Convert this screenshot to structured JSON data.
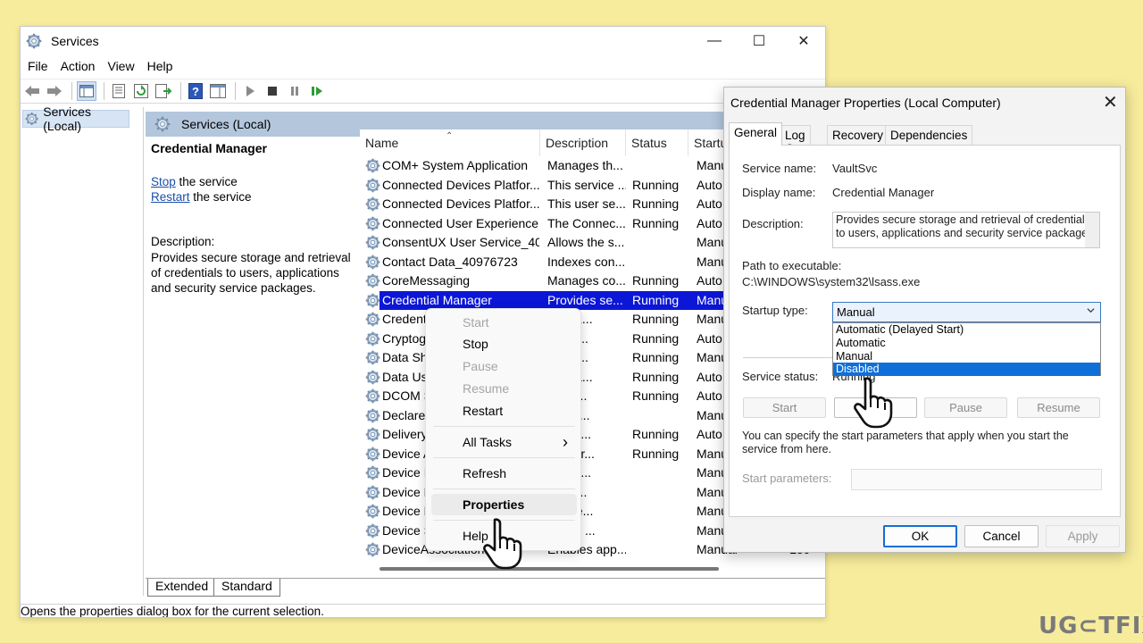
{
  "services_window": {
    "title": "Services",
    "controls": {
      "minimize": "—",
      "maximize": "☐",
      "close": "✕"
    },
    "menu": [
      "File",
      "Action",
      "View",
      "Help"
    ],
    "tree_item": "Services (Local)",
    "content_header": "Services (Local)",
    "detail": {
      "service_name": "Credential Manager",
      "stop_link": "Stop",
      "stop_suffix": " the service",
      "restart_link": "Restart",
      "restart_suffix": " the service",
      "description_label": "Description:",
      "description": "Provides secure storage and retrieval of credentials to users, applications and security service packages."
    },
    "columns": {
      "name": "Name",
      "description": "Description",
      "status": "Status",
      "startup": "Startu"
    },
    "rows": [
      {
        "name": "COM+ System Application",
        "desc": "Manages th...",
        "status": "",
        "startup": "Manu"
      },
      {
        "name": "Connected Devices Platfor...",
        "desc": "This service ...",
        "status": "Running",
        "startup": "Auto"
      },
      {
        "name": "Connected Devices Platfor...",
        "desc": "This user se...",
        "status": "Running",
        "startup": "Auto"
      },
      {
        "name": "Connected User Experience...",
        "desc": "The Connec...",
        "status": "Running",
        "startup": "Auto"
      },
      {
        "name": "ConsentUX User Service_40...",
        "desc": "Allows the s...",
        "status": "",
        "startup": "Manu"
      },
      {
        "name": "Contact Data_40976723",
        "desc": "Indexes con...",
        "status": "",
        "startup": "Manu"
      },
      {
        "name": "CoreMessaging",
        "desc": "Manages co...",
        "status": "Running",
        "startup": "Auto"
      },
      {
        "name": "Credential Manager",
        "desc": "Provides se...",
        "status": "Running",
        "startup": "Manu"
      },
      {
        "name": "Credent",
        "desc": "ntial E...",
        "status": "Running",
        "startup": "Manu"
      },
      {
        "name": "Cryptog",
        "desc": "es thr...",
        "status": "Running",
        "startup": "Auto"
      },
      {
        "name": "Data Sha",
        "desc": "es da...",
        "status": "Running",
        "startup": "Manu"
      },
      {
        "name": "Data Usa",
        "desc": "ork da...",
        "status": "Running",
        "startup": "Auto"
      },
      {
        "name": "DCOM S",
        "desc": "COM...",
        "status": "Running",
        "startup": "Auto"
      },
      {
        "name": "Declared",
        "desc": "s Dec...",
        "status": "",
        "startup": "Manu"
      },
      {
        "name": "Delivery",
        "desc": "ms co...",
        "status": "Running",
        "startup": "Auto"
      },
      {
        "name": "Device A",
        "desc": "es pair...",
        "status": "Running",
        "startup": "Manu"
      },
      {
        "name": "Device I",
        "desc": "es a c...",
        "status": "",
        "startup": "Manu"
      },
      {
        "name": "Device M",
        "desc": "ms D...",
        "status": "",
        "startup": "Manu"
      },
      {
        "name": "Device N",
        "desc": "s Wire...",
        "status": "",
        "startup": "Manu"
      },
      {
        "name": "Device S",
        "desc": "es the ...",
        "status": "",
        "startup": "Manu"
      },
      {
        "name": "DeviceAssociationBr...",
        "desc": "Enables app...",
        "status": "",
        "startup": "Manual",
        "logon": "Loc"
      }
    ],
    "bottom_tabs": [
      "Extended",
      "Standard"
    ],
    "status_text": "Opens the properties dialog box for the current selection."
  },
  "context_menu": {
    "start": "Start",
    "stop": "Stop",
    "pause": "Pause",
    "resume": "Resume",
    "restart": "Restart",
    "all_tasks": "All Tasks",
    "all_tasks_arrow": "›",
    "refresh": "Refresh",
    "properties": "Properties",
    "help": "Help"
  },
  "dialog": {
    "title": "Credential Manager Properties (Local Computer)",
    "close": "✕",
    "tabs": [
      "General",
      "Log On",
      "Recovery",
      "Dependencies"
    ],
    "service_name_label": "Service name:",
    "service_name": "VaultSvc",
    "display_name_label": "Display name:",
    "display_name": "Credential Manager",
    "description_label": "Description:",
    "description": "Provides secure storage and retrieval of credentials to users, applications and security service packages",
    "path_label": "Path to executable:",
    "path": "C:\\WINDOWS\\system32\\lsass.exe",
    "startup_type_label": "Startup type:",
    "startup_type": "Manual",
    "startup_options": [
      "Automatic (Delayed Start)",
      "Automatic",
      "Manual",
      "Disabled"
    ],
    "startup_highlighted": "Disabled",
    "service_status_label": "Service status:",
    "service_status": "Running",
    "buttons": {
      "start": "Start",
      "stop": "Stop",
      "pause": "Pause",
      "resume": "Resume"
    },
    "info_text": "You can specify the start parameters that apply when you start the service from here.",
    "start_params_label": "Start parameters:",
    "ok": "OK",
    "cancel": "Cancel",
    "apply": "Apply"
  },
  "watermark": "UG⊂TFIX",
  "colors": {
    "selection": "#0b16d6",
    "dropdown_highlight": "#0f6fd8",
    "header_band": "#b3c6dc",
    "background": "#f7ec9c"
  }
}
